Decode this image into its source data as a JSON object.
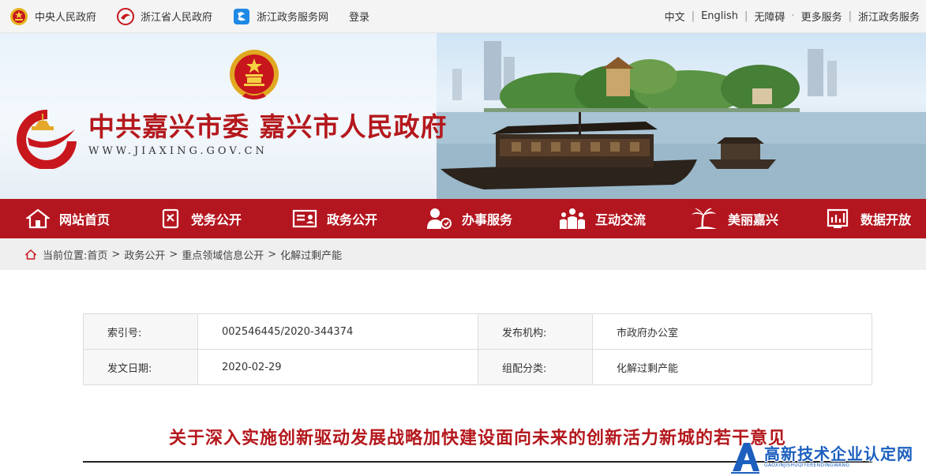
{
  "topbar": {
    "links_left": [
      {
        "label": "中央人民政府",
        "icon": "national-emblem-icon"
      },
      {
        "label": "浙江省人民政府",
        "icon": "zhejiang-gov-icon"
      },
      {
        "label": "浙江政务服务网",
        "icon": "zhejiang-service-icon"
      }
    ],
    "login": "登录",
    "links_right": [
      "中文",
      "English",
      "无障碍",
      "更多服务",
      "浙江政务服务"
    ]
  },
  "banner": {
    "title": "中共嘉兴市委 嘉兴市人民政府",
    "url": "WWW.JIAXING.GOV.CN"
  },
  "nav": [
    {
      "label": "网站首页",
      "icon": "home-icon"
    },
    {
      "label": "党务公开",
      "icon": "party-affairs-icon"
    },
    {
      "label": "政务公开",
      "icon": "gov-affairs-icon"
    },
    {
      "label": "办事服务",
      "icon": "service-icon"
    },
    {
      "label": "互动交流",
      "icon": "interaction-icon"
    },
    {
      "label": "美丽嘉兴",
      "icon": "palm-tree-icon"
    },
    {
      "label": "数据开放",
      "icon": "data-open-icon"
    }
  ],
  "breadcrumb": {
    "prefix": "当前位置:",
    "items": [
      "首页",
      "政务公开",
      "重点领域信息公开",
      "化解过剩产能"
    ]
  },
  "info": {
    "index_label": "索引号:",
    "index_value": "002546445/2020-344374",
    "publisher_label": "发布机构:",
    "publisher_value": "市政府办公室",
    "date_label": "发文日期:",
    "date_value": "2020-02-29",
    "category_label": "组配分类:",
    "category_value": "化解过剩产能"
  },
  "article": {
    "title": "关于深入实施创新驱动发展战略加快建设面向未来的创新活力新城的若干意见"
  },
  "watermark": {
    "main": "高新技术企业认定网",
    "sub": "GAOXINJISHUQIYERENDINGWANG"
  },
  "colors": {
    "brand_red": "#b4161f",
    "title_red": "#b4181d",
    "watermark_blue": "#1c5fbf"
  }
}
